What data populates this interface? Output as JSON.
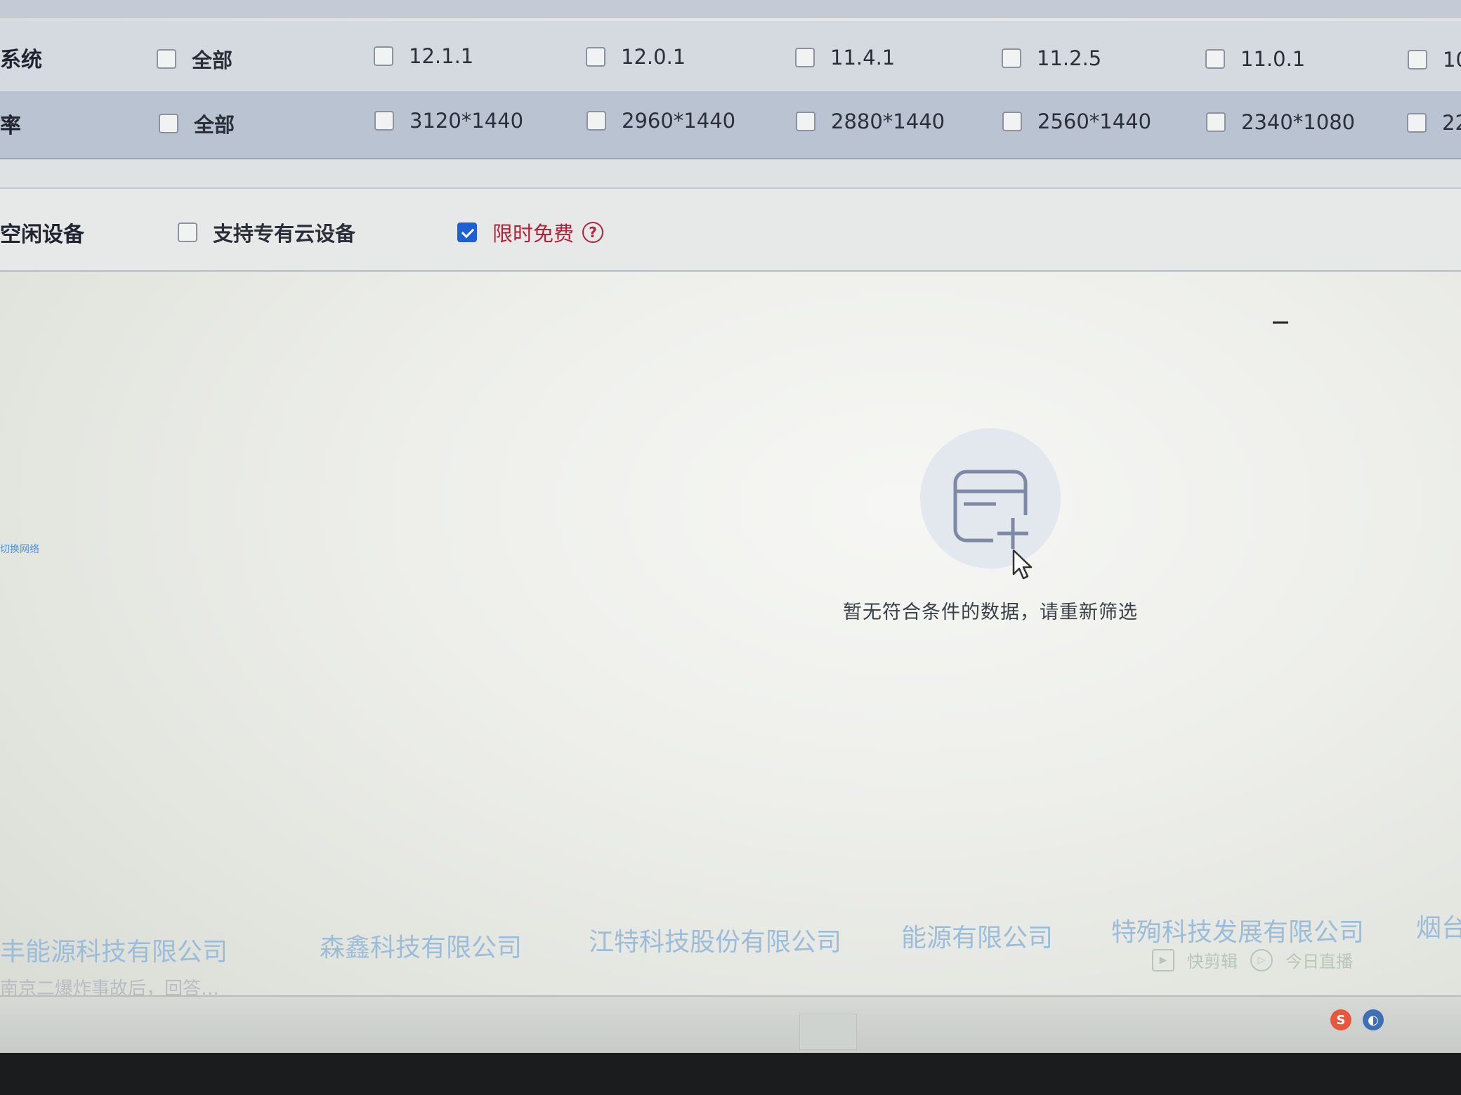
{
  "top_row_partial": [
    "",
    "",
    "",
    "",
    "",
    ""
  ],
  "system_row": {
    "label": "系统",
    "options": [
      "全部",
      "12.1.1",
      "12.0.1",
      "11.4.1",
      "11.2.5",
      "11.0.1",
      "10"
    ]
  },
  "resolution_row": {
    "label": "率",
    "options": [
      "全部",
      "3120*1440",
      "2960*1440",
      "2880*1440",
      "2560*1440",
      "2340*1080",
      "22"
    ]
  },
  "filter_row": {
    "label": "空闲设备",
    "private_cloud_label": "支持专有云设备",
    "free_label": "限时免费",
    "help_glyph": "?"
  },
  "empty_state": {
    "message": "暂无符合条件的数据，请重新筛选",
    "icon": "empty-list-add-icon"
  },
  "footer_links": [
    "丰能源科技有限公司",
    "森鑫科技有限公司",
    "江特科技股份有限公司",
    "能源有限公司",
    "特殉科技发展有限公司",
    "烟台"
  ],
  "footer_note": "南京二爆炸事故后，回答…",
  "footer_tools": [
    "快剪辑",
    "今日直播"
  ],
  "side_link": "切换网络",
  "colors": {
    "accent_blue": "#1f5fd6",
    "free_red": "#b0243a",
    "link_faint": "#9bbdd9"
  }
}
